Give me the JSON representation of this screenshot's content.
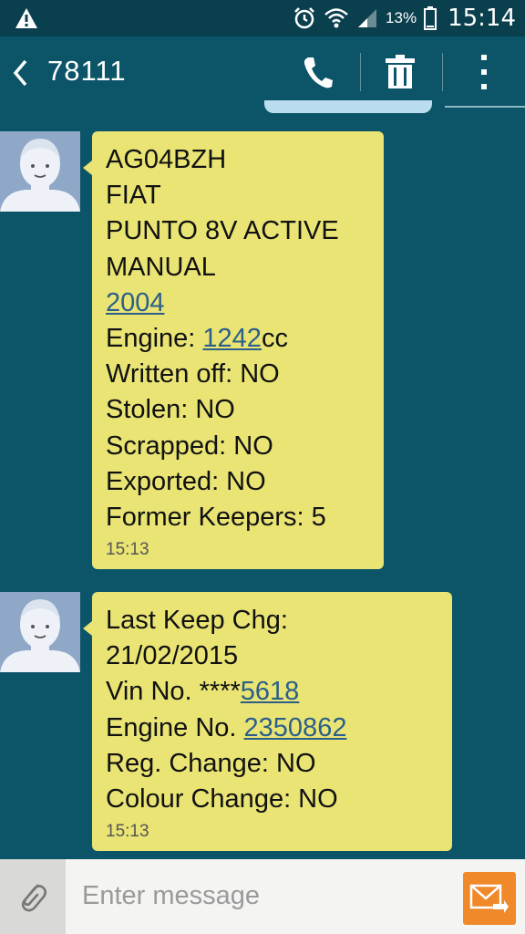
{
  "status_bar": {
    "battery_percent": "13%",
    "time": "15:14",
    "icons": [
      "warning-icon",
      "alarm-icon",
      "wifi-icon",
      "signal-icon",
      "battery-icon"
    ]
  },
  "header": {
    "title": "78111",
    "icons": [
      "back-icon",
      "phone-icon",
      "trash-icon",
      "more-icon"
    ]
  },
  "messages": [
    {
      "lines": [
        {
          "text": "AG04BZH"
        },
        {
          "text": "FIAT"
        },
        {
          "text": "PUNTO 8V ACTIVE"
        },
        {
          "text": "MANUAL"
        },
        {
          "link": "2004"
        },
        {
          "pre": "Engine: ",
          "link": "1242",
          "post": "cc"
        },
        {
          "text": "Written off: NO"
        },
        {
          "text": "Stolen: NO"
        },
        {
          "text": "Scrapped: NO"
        },
        {
          "text": "Exported: NO"
        },
        {
          "text": "Former Keepers: 5"
        }
      ],
      "time": "15:13"
    },
    {
      "lines": [
        {
          "text": "Last Keep Chg:"
        },
        {
          "text": "21/02/2015"
        },
        {
          "pre": "Vin No. ****",
          "link": "5618"
        },
        {
          "pre": "Engine No. ",
          "link": "2350862"
        },
        {
          "text": "Reg. Change: NO"
        },
        {
          "text": "Colour Change: NO"
        }
      ],
      "time": "15:13"
    }
  ],
  "composer": {
    "placeholder": "Enter message",
    "icons": [
      "paperclip-icon",
      "send-icon"
    ]
  },
  "colors": {
    "background": "#0c5468",
    "bubble": "#e9e474",
    "link": "#2b5f8a",
    "send_button": "#f0892a"
  }
}
